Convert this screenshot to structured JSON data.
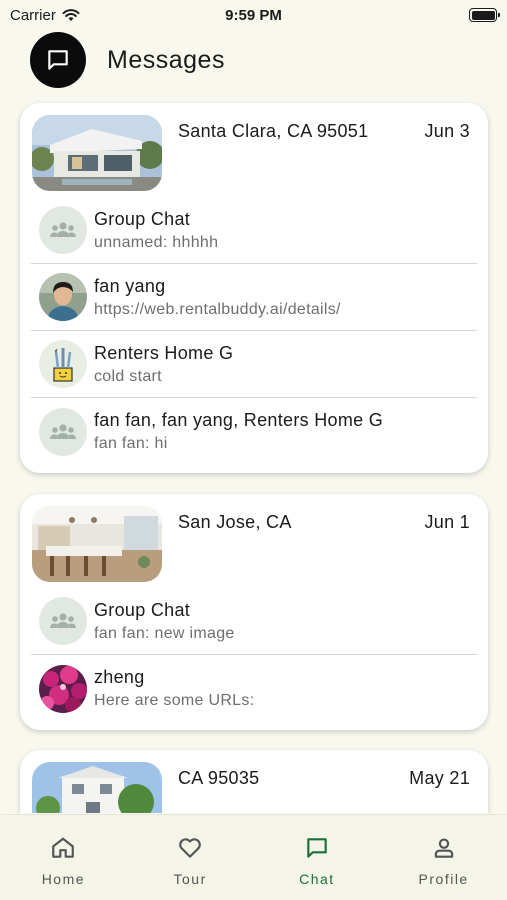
{
  "status_bar": {
    "carrier": "Carrier",
    "time": "9:59 PM"
  },
  "header": {
    "title": "Messages",
    "icon": "chat-bubble-icon"
  },
  "threads": [
    {
      "location": "Santa Clara, CA 95051",
      "date": "Jun 3",
      "chats": [
        {
          "name": "Group Chat",
          "preview": "unnamed: hhhhh",
          "avatar": "group-icon"
        },
        {
          "name": "fan yang",
          "preview": "https://web.rentalbuddy.ai/details/",
          "avatar": "user-photo"
        },
        {
          "name": "Renters Home G",
          "preview": "cold start",
          "avatar": "cactus-pot-image"
        },
        {
          "name": "fan fan, fan yang, Renters Home G",
          "preview": "fan fan: hi",
          "avatar": "group-icon"
        }
      ]
    },
    {
      "location": "San Jose, CA",
      "date": "Jun 1",
      "chats": [
        {
          "name": "Group Chat",
          "preview": "fan fan: new image",
          "avatar": "group-icon"
        },
        {
          "name": "zheng",
          "preview": "Here are some URLs:",
          "avatar": "flowers-photo"
        }
      ]
    },
    {
      "location": "CA 95035",
      "date": "May 21",
      "chats": []
    }
  ],
  "tabs": [
    {
      "label": "Home",
      "icon": "home-icon",
      "active": false
    },
    {
      "label": "Tour",
      "icon": "heart-icon",
      "active": false
    },
    {
      "label": "Chat",
      "icon": "chat-bubble-icon",
      "active": true
    },
    {
      "label": "Profile",
      "icon": "person-icon",
      "active": false
    }
  ],
  "colors": {
    "background": "#f8f8ef",
    "active_tab": "#1f6e3a",
    "group_avatar_bg": "#e1e8e2"
  }
}
